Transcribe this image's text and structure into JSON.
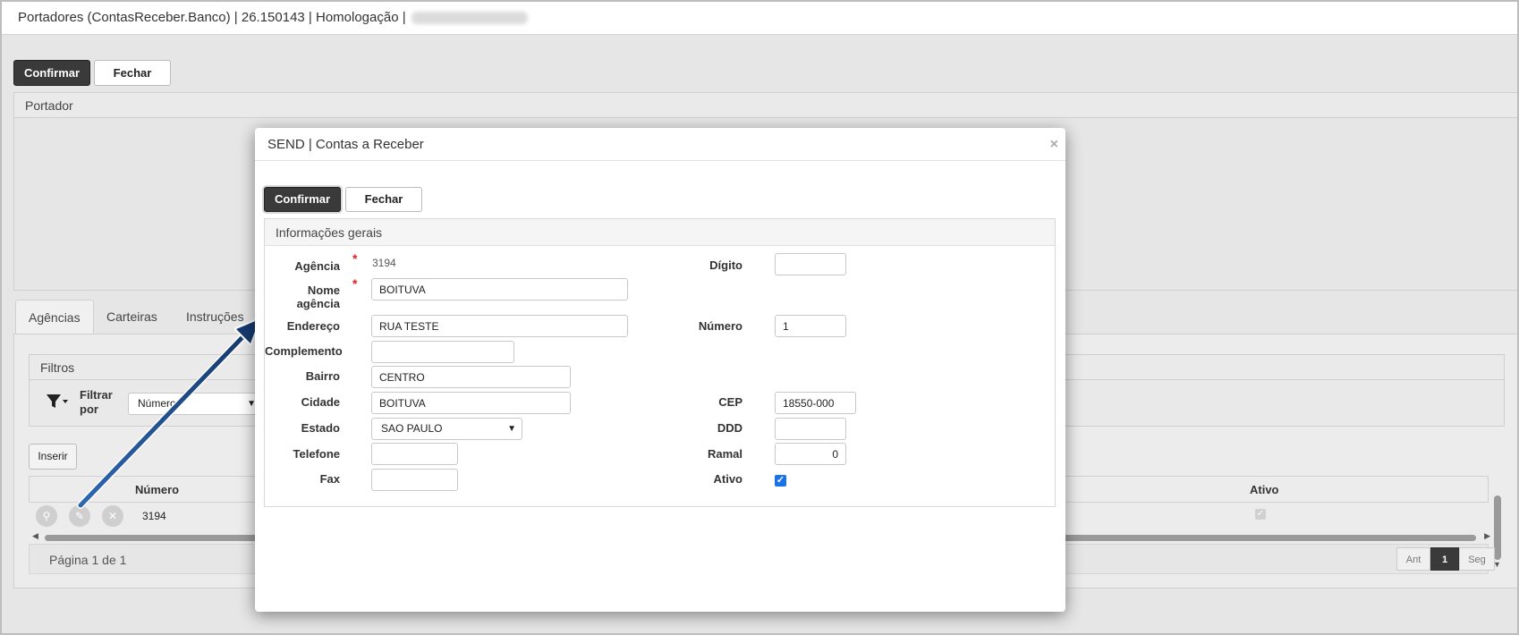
{
  "window": {
    "title": "Portadores (ContasReceber.Banco) | 26.150143 | Homologação |"
  },
  "toolbar": {
    "confirm_label": "Confirmar",
    "close_label": "Fechar"
  },
  "portador_panel": {
    "title": "Portador"
  },
  "tabs": [
    {
      "label": "Agências"
    },
    {
      "label": "Carteiras"
    },
    {
      "label": "Instruções"
    }
  ],
  "filters": {
    "title": "Filtros",
    "filter_by_label": "Filtrar por",
    "filter_select_value": "Número",
    "filter_icon": "filter-icon"
  },
  "grid": {
    "insert_label": "Inserir",
    "columns": {
      "numero": "Número",
      "ativo": "Ativo"
    },
    "rows": [
      {
        "numero": "3194",
        "ativo": true
      }
    ],
    "pagination_text": "Página 1 de 1",
    "pager": {
      "prev": "Ant",
      "current": "1",
      "next": "Seg"
    }
  },
  "modal": {
    "title": "SEND | Contas a Receber",
    "close_glyph": "×",
    "confirm_label": "Confirmar",
    "close_label": "Fechar",
    "section_title": "Informações gerais",
    "required_mark": "*",
    "fields": {
      "agencia": {
        "label": "Agência",
        "value": "3194"
      },
      "digito": {
        "label": "Dígito",
        "value": ""
      },
      "nome_agencia": {
        "label": "Nome agência",
        "value": "BOITUVA"
      },
      "endereco": {
        "label": "Endereço",
        "value": "RUA TESTE"
      },
      "numero": {
        "label": "Número",
        "value": "1"
      },
      "complemento": {
        "label": "Complemento",
        "value": ""
      },
      "bairro": {
        "label": "Bairro",
        "value": "CENTRO"
      },
      "cidade": {
        "label": "Cidade",
        "value": "BOITUVA"
      },
      "cep": {
        "label": "CEP",
        "value": "18550-000"
      },
      "estado": {
        "label": "Estado",
        "value": "SAO PAULO"
      },
      "ddd": {
        "label": "DDD",
        "value": ""
      },
      "telefone": {
        "label": "Telefone",
        "value": ""
      },
      "ramal": {
        "label": "Ramal",
        "value": "0"
      },
      "fax": {
        "label": "Fax",
        "value": ""
      },
      "ativo": {
        "label": "Ativo",
        "checked": true
      }
    }
  },
  "colors": {
    "dark_button": "#3a3a3a",
    "arrow": "#1f4e8c",
    "checkbox": "#1a73e8",
    "required": "#e02020"
  }
}
